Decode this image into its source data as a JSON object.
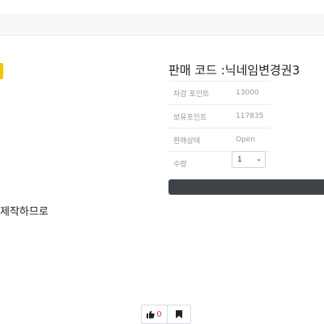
{
  "product": {
    "title": "판매 코드 :닉네임변경권3",
    "info": [
      {
        "label": "차감 포인트",
        "value": "13000"
      },
      {
        "label": "보유포인트",
        "value": "117835"
      },
      {
        "label": "판매상태",
        "value": "Open"
      },
      {
        "label": "수량",
        "value": ""
      }
    ],
    "quantity": {
      "selected": "1"
    }
  },
  "description": "제작하므로",
  "actions": {
    "like_count": "0"
  },
  "colors": {
    "brand_yellow": "#f3c400",
    "buy_bar": "#3d4349",
    "like_count": "#e03c31"
  }
}
